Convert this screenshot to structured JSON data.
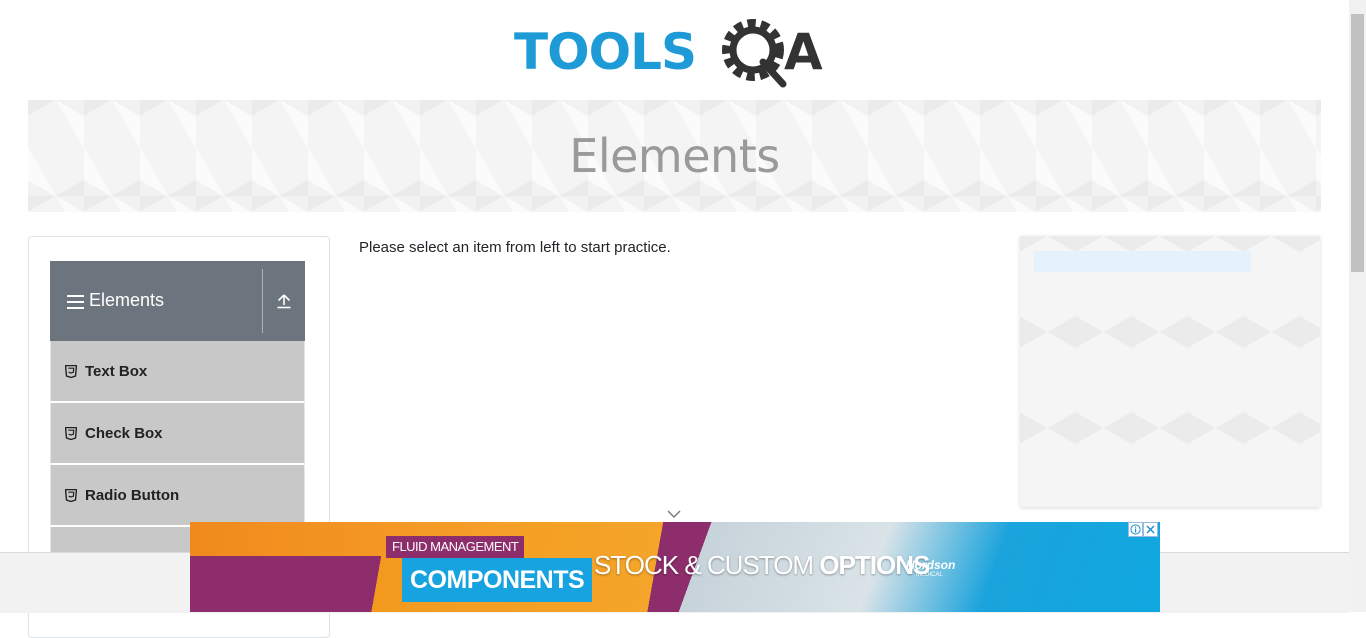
{
  "header": {
    "logo_text_left": "TOOLS",
    "logo_text_right": "A",
    "logo_color": "#1e9bd7",
    "logo_dark": "#333333"
  },
  "banner": {
    "title": "Elements"
  },
  "sidebar": {
    "group_title": "Elements",
    "group_icon": "hamburger-icon",
    "collapse_icon": "upload-arrow-icon",
    "items": [
      {
        "label": "Text Box",
        "icon": "html5-icon"
      },
      {
        "label": "Check Box",
        "icon": "html5-icon"
      },
      {
        "label": "Radio Button",
        "icon": "html5-icon"
      }
    ]
  },
  "main": {
    "message": "Please select an item from left to start practice."
  },
  "bottom_ad": {
    "small_text": "FLUID MANAGEMENT",
    "big_text": "COMPONENTS",
    "tagline_light": "STOCK & CUSTOM ",
    "tagline_bold": "OPTIONS",
    "brand": "Nordson",
    "brand_sub": "MEDICAL",
    "info_icon": "info-icon",
    "close_icon": "close-icon"
  },
  "colors": {
    "sidebar_header": "#6c757d",
    "menu_item_bg": "#c8c8c8",
    "banner_text": "#9a9a9a"
  }
}
